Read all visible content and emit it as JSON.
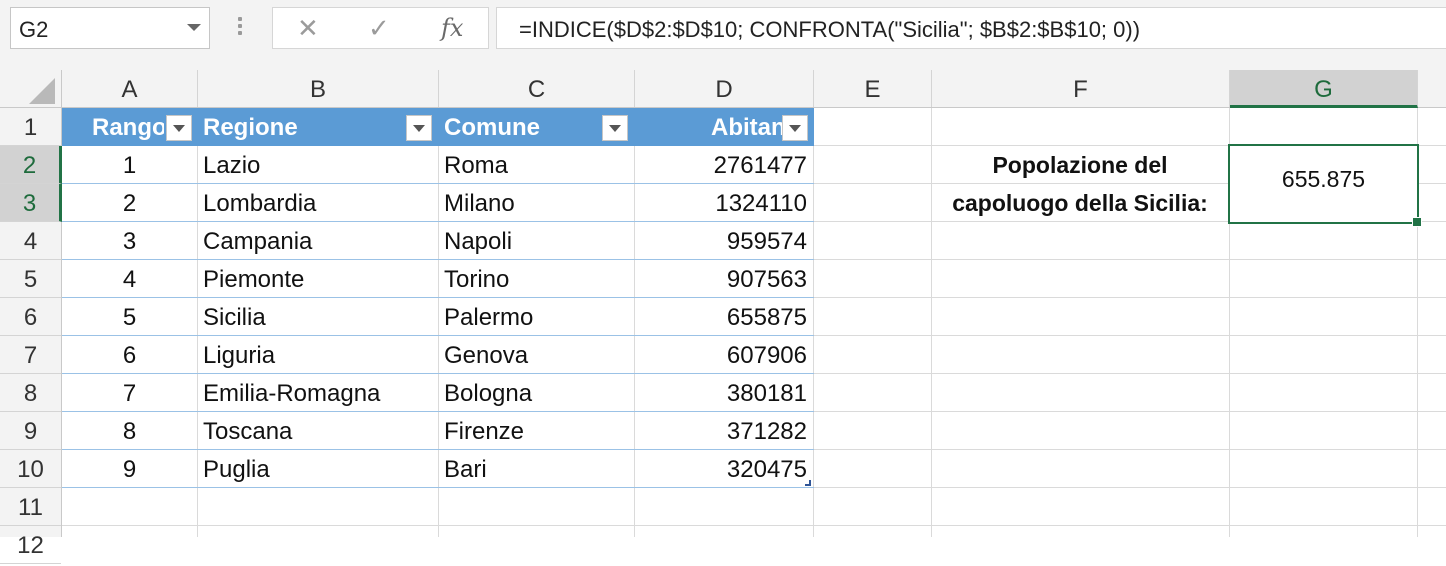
{
  "formula_bar": {
    "name_box": "G2",
    "cancel_glyph": "✕",
    "enter_glyph": "✓",
    "fx_glyph": "fx",
    "formula": "=INDICE($D$2:$D$10; CONFRONTA(\"Sicilia\"; $B$2:$B$10; 0))"
  },
  "columns": [
    "A",
    "B",
    "C",
    "D",
    "E",
    "F",
    "G"
  ],
  "rows": [
    "1",
    "2",
    "3",
    "4",
    "5",
    "6",
    "7",
    "8",
    "9",
    "10",
    "11",
    "12"
  ],
  "table": {
    "headers": [
      "Rango",
      "Regione",
      "Comune",
      "Abitanti"
    ],
    "rows": [
      [
        "1",
        "Lazio",
        "Roma",
        "2761477"
      ],
      [
        "2",
        "Lombardia",
        "Milano",
        "1324110"
      ],
      [
        "3",
        "Campania",
        "Napoli",
        "959574"
      ],
      [
        "4",
        "Piemonte",
        "Torino",
        "907563"
      ],
      [
        "5",
        "Sicilia",
        "Palermo",
        "655875"
      ],
      [
        "6",
        "Liguria",
        "Genova",
        "607906"
      ],
      [
        "7",
        "Emilia-Romagna",
        "Bologna",
        "380181"
      ],
      [
        "8",
        "Toscana",
        "Firenze",
        "371282"
      ],
      [
        "9",
        "Puglia",
        "Bari",
        "320475"
      ]
    ]
  },
  "label_f": {
    "line1": "Popolazione del",
    "line2": "capoluogo della Sicilia:"
  },
  "result_g2": "655.875",
  "colors": {
    "table_header": "#5b9bd5",
    "table_row_line": "#9bc2e6",
    "selection_green": "#217346"
  }
}
